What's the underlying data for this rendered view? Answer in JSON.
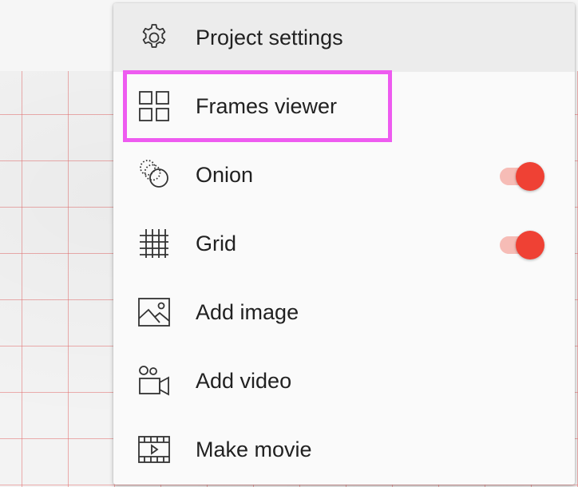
{
  "menu": {
    "items": [
      {
        "label": "Project settings",
        "icon": "gear-icon"
      },
      {
        "label": "Frames viewer",
        "icon": "frames-grid-icon"
      },
      {
        "label": "Onion",
        "icon": "onion-skin-icon",
        "toggle_on": true
      },
      {
        "label": "Grid",
        "icon": "grid-icon",
        "toggle_on": true
      },
      {
        "label": "Add image",
        "icon": "image-icon"
      },
      {
        "label": "Add video",
        "icon": "video-camera-icon"
      },
      {
        "label": "Make movie",
        "icon": "movie-film-icon"
      }
    ]
  },
  "colors": {
    "highlight": "#ee5bf0",
    "toggle_thumb": "#ef4134",
    "toggle_track": "#f6bcb6",
    "grid_line": "#e26e6e"
  }
}
